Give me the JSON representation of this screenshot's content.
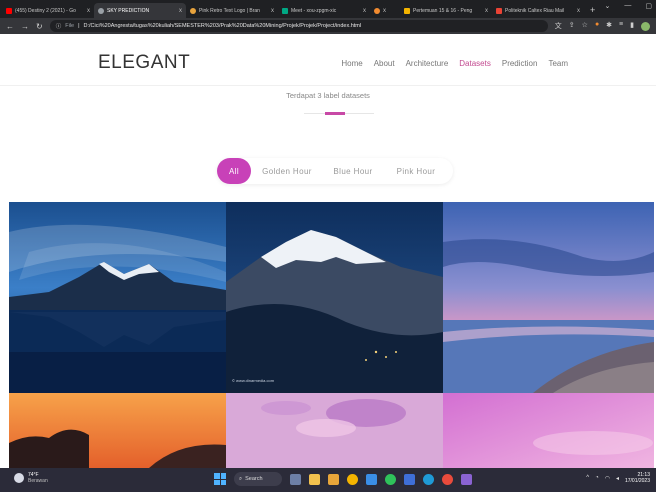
{
  "browser": {
    "tabs": [
      {
        "label": "(455) Destiny 2 (2021) - Go",
        "favicon_color": "#ff0000",
        "active": false
      },
      {
        "label": "SKY PREDICTION",
        "favicon_color": "#9aa0a6",
        "active": true
      },
      {
        "label": "Pink Retro Text Logo | Bran",
        "favicon_color": "#e8a33d",
        "active": false
      },
      {
        "label": "Meet - xou-zpgm-xic",
        "favicon_color": "#00a884",
        "active": false
      },
      {
        "label": "",
        "favicon_color": "#f28b30",
        "active": false
      },
      {
        "label": "Pertemuan 15 & 16 - Peng",
        "favicon_color": "#f4b400",
        "active": false
      },
      {
        "label": "Politeknik Caltex Riau Mail",
        "favicon_color": "#ea4335",
        "active": false
      }
    ],
    "tab_close": "x",
    "new_tab": "+",
    "url_scheme": "File",
    "url": "D:/Cici%20Angresta/tugas%20kuliah/SEMESTER%203/Prak%20Data%20Mining/Projek/Projek/Project/index.html"
  },
  "site": {
    "logo": "ELEGANT",
    "nav": [
      "Home",
      "About",
      "Architecture",
      "Datasets",
      "Prediction",
      "Team"
    ],
    "nav_active": "Datasets",
    "subtitle": "Terdapat 3 label datasets",
    "filters": [
      "All",
      "Golden Hour",
      "Blue Hour",
      "Pink Hour"
    ],
    "filter_active": "All",
    "accent_color": "#c841b8",
    "image_credit": "© www.dinarmedia.com"
  },
  "taskbar": {
    "weather_temp": "74°F",
    "weather_desc": "Berawan",
    "search_label": "Search",
    "time": "21:13",
    "date": "17/01/2023"
  }
}
